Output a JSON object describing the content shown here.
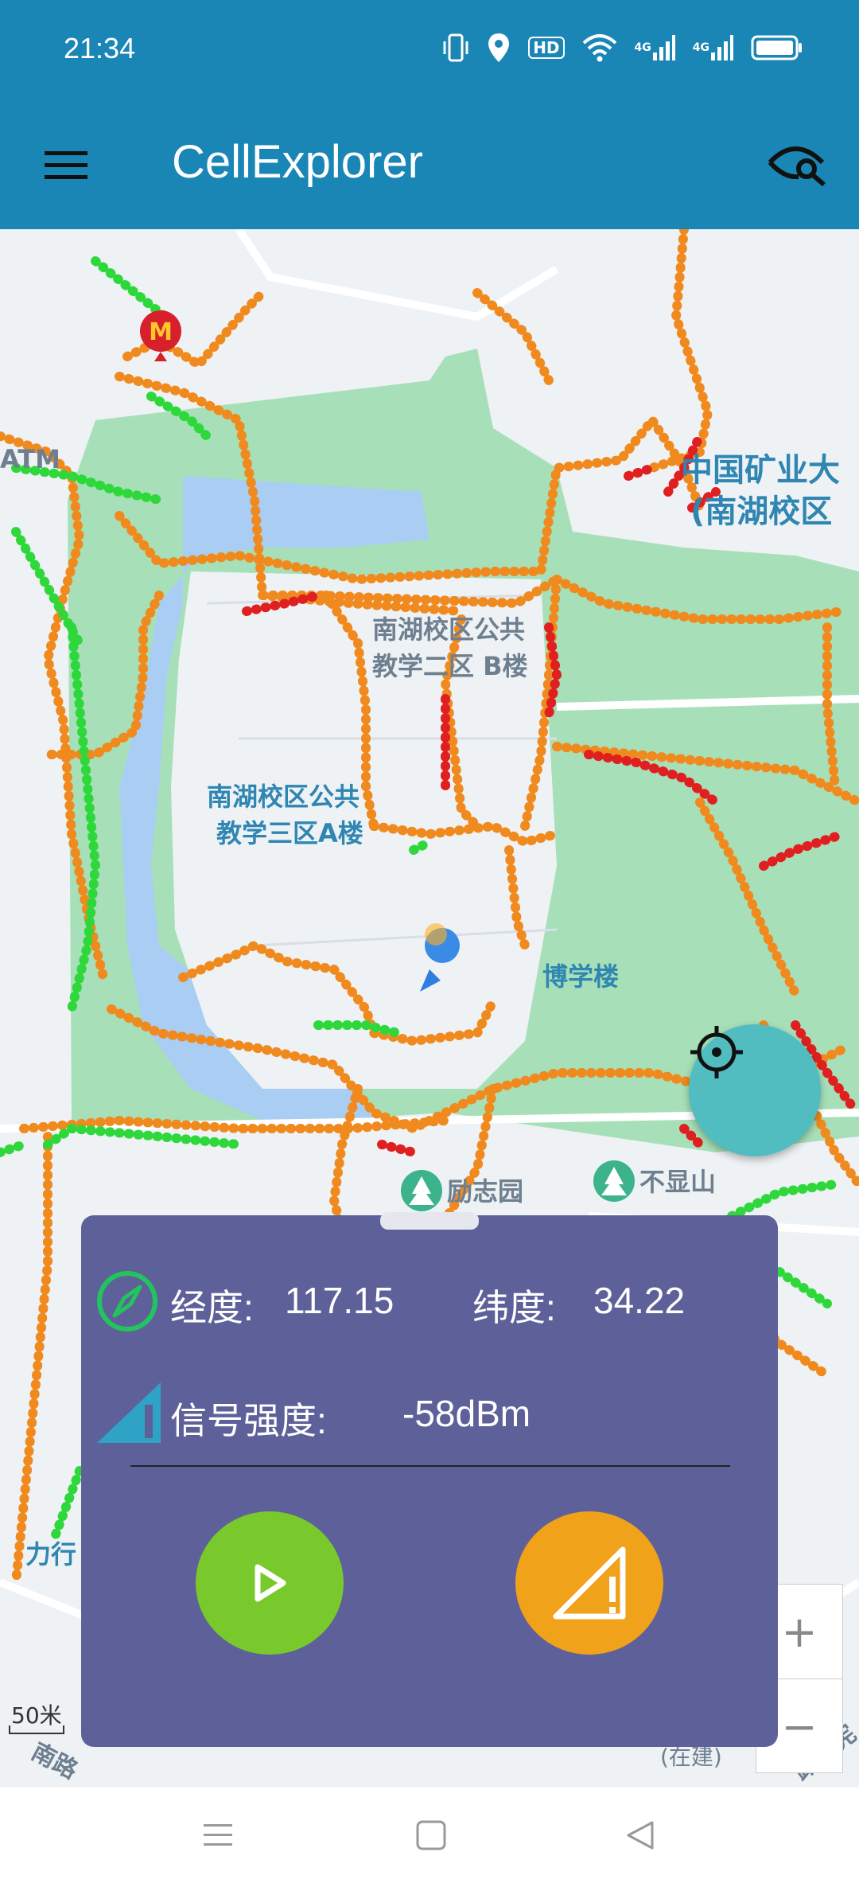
{
  "status": {
    "time": "21:34",
    "icons": [
      "vibrate-icon",
      "location-icon",
      "hd-icon",
      "wifi-icon",
      "signal-4g-icon",
      "signal-4g-icon",
      "battery-icon"
    ],
    "hd_text": "HD",
    "net1": "4G",
    "net2": "4G"
  },
  "appbar": {
    "title": "CellExplorer"
  },
  "map": {
    "labels": {
      "atm": "ATM",
      "university_line1": "中国矿业大",
      "university_line2": "(南湖校区",
      "building_b_line1": "南湖校区公共",
      "building_b_line2": "教学二区 B楼",
      "building_a_line1": "南湖校区公共",
      "building_a_line2": "教学三区A楼",
      "boxue": "博学楼",
      "lizhiyuan": "励志园",
      "buxianshan": "不显山",
      "lixing": "力行",
      "road_right": "路藩宪",
      "road_bottom": "南路",
      "under_construction": "(在建)",
      "scale": "50米"
    }
  },
  "panel": {
    "lon_label": "经度:",
    "lon_value": "117.15",
    "lat_label": "纬度:",
    "lat_value": "34.22",
    "signal_label": "信号强度:",
    "signal_value": "-58dBm"
  },
  "colors": {
    "primary": "#1a86b6",
    "panel": "#5e6199",
    "play": "#7ac92c",
    "measure": "#f0a21a",
    "locate": "#52bdc0",
    "track_orange": "#f08a1e",
    "track_green": "#2ed83a",
    "track_red": "#e02020"
  },
  "zoom": {
    "plus": "+",
    "minus": "−"
  }
}
